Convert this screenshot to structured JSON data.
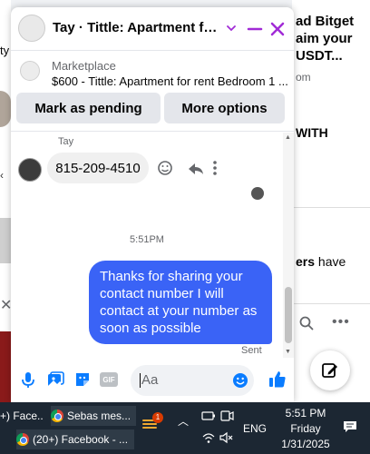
{
  "background": {
    "left_text": "ty",
    "ad_title": "ad Bitget aim your USDT...",
    "ad_url": "om",
    "with_text": "WITH",
    "others_bold": "ers",
    "others_rest": " have"
  },
  "chat": {
    "title": "Tay · Tittle: Apartment for ...",
    "marketplace": {
      "source": "Marketplace",
      "listing": "$600 - Tittle: Apartment for rent Bedroom 1 ...",
      "mark_pending_label": "Mark as pending",
      "more_options_label": "More options"
    },
    "messages": {
      "sender_name": "Tay",
      "incoming_text": "815-209-4510",
      "timestamp": "5:51PM",
      "outgoing_text": "Thanks for sharing your contact number I will contact at your number as soon as possible",
      "status": "Sent"
    },
    "composer": {
      "placeholder": "Aa"
    }
  },
  "taskbar": {
    "item1": "+) Face...",
    "item2": "Sebas mes...",
    "item3": "(20+) Facebook - ...",
    "weather_badge": "1",
    "language": "ENG",
    "time": "5:51 PM",
    "day": "Friday",
    "date": "1/31/2025"
  },
  "colors": {
    "accent": "#3a63f6",
    "header_icons": "#a12bd6",
    "messenger_blue": "#0a7cff",
    "taskbar": "#1c2733"
  }
}
